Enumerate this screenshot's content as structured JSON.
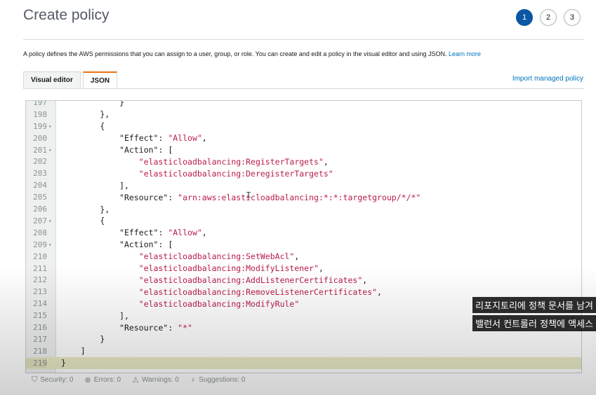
{
  "page": {
    "title": "Create policy",
    "description": "A policy defines the AWS permissions that you can assign to a user, group, or role. You can create and edit a policy in the visual editor and using JSON.",
    "learn_more": "Learn more",
    "import_link": "Import managed policy"
  },
  "steps": [
    "1",
    "2",
    "3"
  ],
  "active_step": 1,
  "tabs": [
    {
      "label": "Visual editor",
      "active": false
    },
    {
      "label": "JSON",
      "active": true
    }
  ],
  "editor": {
    "lines": [
      {
        "n": "197",
        "fold": false,
        "indent": 3,
        "text": "}"
      },
      {
        "n": "198",
        "fold": false,
        "indent": 2,
        "text": "},"
      },
      {
        "n": "199",
        "fold": true,
        "indent": 2,
        "text": "{"
      },
      {
        "n": "200",
        "fold": false,
        "indent": 3,
        "key": "\"Effect\": ",
        "str": "\"Allow\"",
        "tail": ","
      },
      {
        "n": "201",
        "fold": true,
        "indent": 3,
        "key": "\"Action\": [",
        "str": "",
        "tail": ""
      },
      {
        "n": "202",
        "fold": false,
        "indent": 4,
        "key": "",
        "str": "\"elasticloadbalancing:RegisterTargets\"",
        "tail": ","
      },
      {
        "n": "203",
        "fold": false,
        "indent": 4,
        "key": "",
        "str": "\"elasticloadbalancing:DeregisterTargets\"",
        "tail": ""
      },
      {
        "n": "204",
        "fold": false,
        "indent": 3,
        "text": "],"
      },
      {
        "n": "205",
        "fold": false,
        "indent": 3,
        "key": "\"Resource\": ",
        "str": "\"arn:aws:elasticloadbalancing:*:*:targetgroup/*/*\"",
        "tail": ""
      },
      {
        "n": "206",
        "fold": false,
        "indent": 2,
        "text": "},"
      },
      {
        "n": "207",
        "fold": true,
        "indent": 2,
        "text": "{"
      },
      {
        "n": "208",
        "fold": false,
        "indent": 3,
        "key": "\"Effect\": ",
        "str": "\"Allow\"",
        "tail": ","
      },
      {
        "n": "209",
        "fold": true,
        "indent": 3,
        "key": "\"Action\": [",
        "str": "",
        "tail": ""
      },
      {
        "n": "210",
        "fold": false,
        "indent": 4,
        "key": "",
        "str": "\"elasticloadbalancing:SetWebAcl\"",
        "tail": ","
      },
      {
        "n": "211",
        "fold": false,
        "indent": 4,
        "key": "",
        "str": "\"elasticloadbalancing:ModifyListener\"",
        "tail": ","
      },
      {
        "n": "212",
        "fold": false,
        "indent": 4,
        "key": "",
        "str": "\"elasticloadbalancing:AddListenerCertificates\"",
        "tail": ","
      },
      {
        "n": "213",
        "fold": false,
        "indent": 4,
        "key": "",
        "str": "\"elasticloadbalancing:RemoveListenerCertificates\"",
        "tail": ","
      },
      {
        "n": "214",
        "fold": false,
        "indent": 4,
        "key": "",
        "str": "\"elasticloadbalancing:ModifyRule\"",
        "tail": ""
      },
      {
        "n": "215",
        "fold": false,
        "indent": 3,
        "text": "],"
      },
      {
        "n": "216",
        "fold": false,
        "indent": 3,
        "key": "\"Resource\": ",
        "str": "\"*\"",
        "tail": ""
      },
      {
        "n": "217",
        "fold": false,
        "indent": 2,
        "text": "}"
      },
      {
        "n": "218",
        "fold": false,
        "indent": 1,
        "text": "]"
      },
      {
        "n": "219",
        "fold": false,
        "indent": 0,
        "text": "}",
        "highlight": true
      }
    ]
  },
  "status_bar": {
    "security": "Security: 0",
    "errors": "Errors: 0",
    "warnings": "Warnings: 0",
    "suggestions": "Suggestions: 0"
  },
  "subtitles": [
    "리포지토리에 정책 문서를 남겨",
    "밸런서 컨트롤러 정책에 액세스"
  ],
  "colors": {
    "accent": "#0b57a3",
    "link": "#0073bb",
    "tab_active": "#ec7211",
    "json_string": "#b91c47",
    "current_line": "#e9eac6"
  }
}
